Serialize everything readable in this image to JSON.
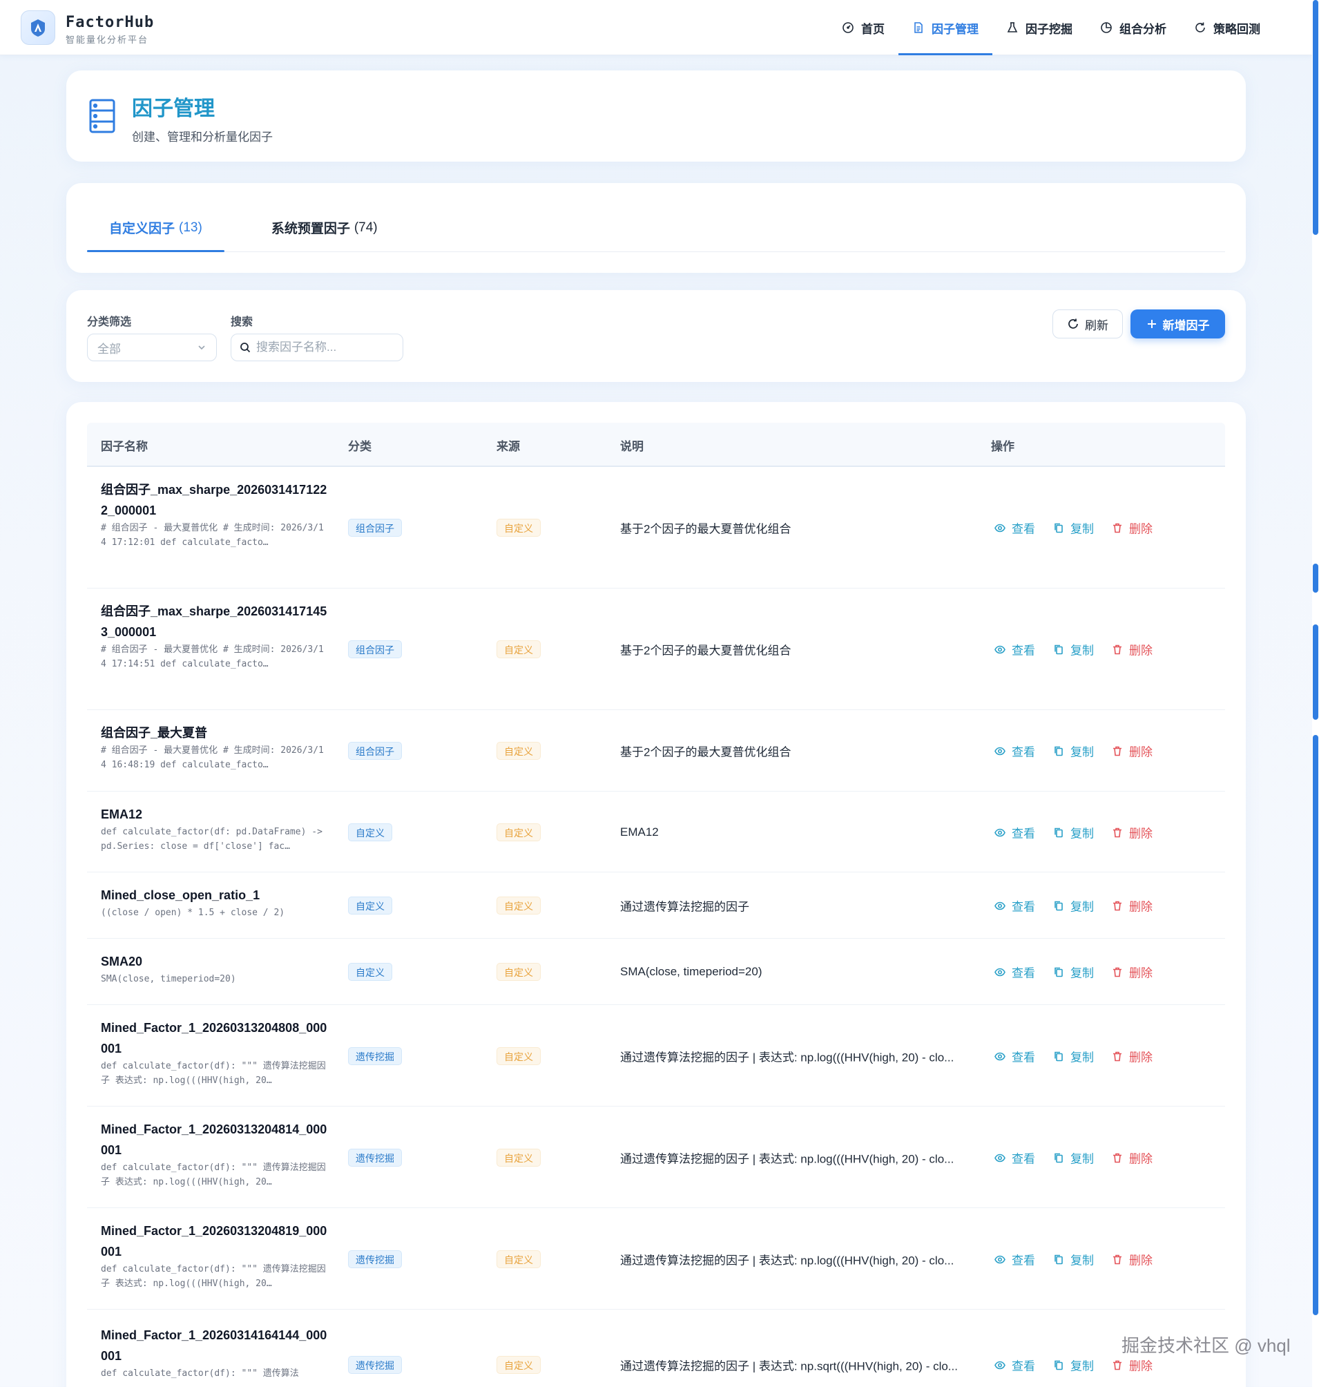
{
  "brand": {
    "name": "FactorHub",
    "subtitle": "智能量化分析平台"
  },
  "nav": [
    {
      "label": "首页",
      "icon": "dashboard-icon",
      "active": false
    },
    {
      "label": "因子管理",
      "icon": "document-icon",
      "active": true
    },
    {
      "label": "因子挖掘",
      "icon": "flask-icon",
      "active": false
    },
    {
      "label": "组合分析",
      "icon": "pie-chart-icon",
      "active": false
    },
    {
      "label": "策略回测",
      "icon": "refresh-icon",
      "active": false
    }
  ],
  "header": {
    "title": "因子管理",
    "subtitle": "创建、管理和分析量化因子"
  },
  "tabs": [
    {
      "label": "自定义因子",
      "count": "(13)",
      "active": true
    },
    {
      "label": "系统预置因子",
      "count": "(74)",
      "active": false
    }
  ],
  "filters": {
    "category_label": "分类筛选",
    "category_value": "全部",
    "search_label": "搜索",
    "search_placeholder": "搜索因子名称..."
  },
  "buttons": {
    "refresh": "刷新",
    "add": "新增因子"
  },
  "table": {
    "headers": {
      "name": "因子名称",
      "category": "分类",
      "source": "来源",
      "desc": "说明",
      "ops": "操作"
    },
    "op_labels": {
      "view": "查看",
      "copy": "复制",
      "delete": "删除"
    },
    "rows": [
      {
        "name": "组合因子_max_sharpe_20260314171222_000001",
        "code": "# 组合因子 - 最大夏普优化 # 生成时间: 2026/3/14 17:12:01 def calculate_facto…",
        "category": "组合因子",
        "source": "自定义",
        "desc": "基于2个因子的最大夏普优化组合"
      },
      {
        "name": "组合因子_max_sharpe_20260314171453_000001",
        "code": "# 组合因子 - 最大夏普优化 # 生成时间: 2026/3/14 17:14:51 def calculate_facto…",
        "category": "组合因子",
        "source": "自定义",
        "desc": "基于2个因子的最大夏普优化组合"
      },
      {
        "name": "组合因子_最大夏普",
        "code": "# 组合因子 - 最大夏普优化 # 生成时间: 2026/3/14 16:48:19 def calculate_facto…",
        "category": "组合因子",
        "source": "自定义",
        "desc": "基于2个因子的最大夏普优化组合"
      },
      {
        "name": "EMA12",
        "code": "def calculate_factor(df: pd.DataFrame) -> pd.Series: close = df['close'] fac…",
        "category": "自定义",
        "source": "自定义",
        "desc": "EMA12"
      },
      {
        "name": "Mined_close_open_ratio_1",
        "code": "((close / open) * 1.5 + close / 2)",
        "category": "自定义",
        "source": "自定义",
        "desc": "通过遗传算法挖掘的因子"
      },
      {
        "name": "SMA20",
        "code": "SMA(close, timeperiod=20)",
        "category": "自定义",
        "source": "自定义",
        "desc": "SMA(close, timeperiod=20)"
      },
      {
        "name": "Mined_Factor_1_20260313204808_000001",
        "code": "def calculate_factor(df): \"\"\" 遗传算法挖掘因子 表达式: np.log(((HHV(high, 20…",
        "category": "遗传挖掘",
        "source": "自定义",
        "desc": "通过遗传算法挖掘的因子 | 表达式: np.log(((HHV(high, 20) - clo..."
      },
      {
        "name": "Mined_Factor_1_20260313204814_000001",
        "code": "def calculate_factor(df): \"\"\" 遗传算法挖掘因子 表达式: np.log(((HHV(high, 20…",
        "category": "遗传挖掘",
        "source": "自定义",
        "desc": "通过遗传算法挖掘的因子 | 表达式: np.log(((HHV(high, 20) - clo..."
      },
      {
        "name": "Mined_Factor_1_20260313204819_000001",
        "code": "def calculate_factor(df): \"\"\" 遗传算法挖掘因子 表达式: np.log(((HHV(high, 20…",
        "category": "遗传挖掘",
        "source": "自定义",
        "desc": "通过遗传算法挖掘的因子 | 表达式: np.log(((HHV(high, 20) - clo..."
      },
      {
        "name": "Mined_Factor_1_20260314164144_000001",
        "code": "def calculate_factor(df): \"\"\" 遗传算法",
        "category": "遗传挖掘",
        "source": "自定义",
        "desc": "通过遗传算法挖掘的因子 | 表达式: np.sqrt(((HHV(high, 20) - clo..."
      }
    ]
  },
  "watermark": "掘金技术社区 @ vhql",
  "colors": {
    "accent": "#2f7de1",
    "title": "#2196c9",
    "danger": "#e4545a",
    "tag_source": "#e8a33d"
  }
}
